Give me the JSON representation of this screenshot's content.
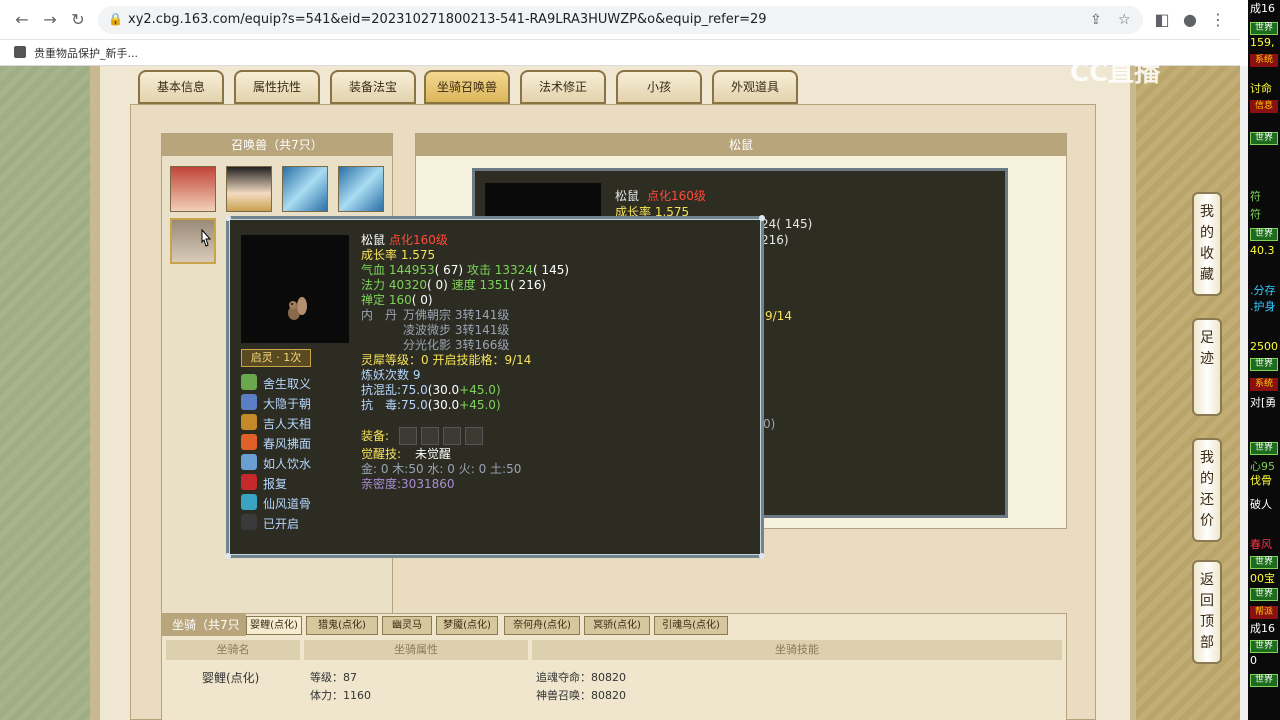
{
  "browser": {
    "url": "xy2.cbg.163.com/equip?s=541&eid=202310271800213-541-RA9LRA3HUWZP&o&equip_refer=29",
    "bookmark": "贵重物品保护_新手..."
  },
  "tabs": [
    "基本信息",
    "属性抗性",
    "装备法宝",
    "坐骑召唤兽",
    "法术修正",
    "小孩",
    "外观道具"
  ],
  "active_tab": "坐骑召唤兽",
  "pet_panel": {
    "title": "召唤兽（共7只）"
  },
  "detail_panel": {
    "title": "松鼠",
    "bg_name": "松鼠",
    "bg_level": "点化160级",
    "bg_growth": "成长率 1.575",
    "bg_attack_tail": "24( 145)",
    "bg_speed_tail": "216)",
    "bg_slots_tail": "9/14",
    "bg_misc_tail": "0)"
  },
  "popup": {
    "name": "松鼠",
    "level": "点化160级",
    "growth": "成长率 1.575",
    "hp_label": "气血",
    "hp_value": "144953",
    "hp_bonus": "( 67)",
    "atk_label": "攻击",
    "atk_value": "13324",
    "atk_bonus": "( 145)",
    "mp_label": "法力",
    "mp_value": "40320",
    "mp_bonus": "( 0)",
    "spd_label": "速度",
    "spd_value": "1351",
    "spd_bonus": "( 216)",
    "chan_label": "禅定",
    "chan_value": "160",
    "chan_bonus": "( 0)",
    "neidan_label": "内　丹",
    "neidan": [
      "万佛朝宗 3转141级",
      "凌波微步 3转141级",
      "分光化影 3转166级"
    ],
    "lingxi": "灵犀等级：0 开启技能格：9/14",
    "lianyao": "炼妖次数 9",
    "resist1_label": "抗混乱:",
    "resist1_value": "75.0",
    "resist1_base": "(30.0",
    "resist1_plus": "+45.0)",
    "resist2_label": "抗　毒:",
    "resist2_value": "75.0",
    "resist2_base": "(30.0",
    "resist2_plus": "+45.0)",
    "equip_label": "装备:",
    "awaken_label": "觉醒技:",
    "awaken_value": "未觉醒",
    "elements": "金: 0 木:50 水: 0 火: 0 土:50",
    "intimacy": "亲密度:3031860",
    "qiling": "启灵 · 1次",
    "skills": [
      {
        "name": "舍生取义",
        "color": "#6aa84f"
      },
      {
        "name": "大隐于朝",
        "color": "#5b7fc4"
      },
      {
        "name": "吉人天相",
        "color": "#c48a2a"
      },
      {
        "name": "春风拂面",
        "color": "#e0602a"
      },
      {
        "name": "如人饮水",
        "color": "#6a9fd4"
      },
      {
        "name": "报复",
        "color": "#c42a2a"
      },
      {
        "name": "仙风道骨",
        "color": "#3aa4c4"
      },
      {
        "name": "已开启",
        "color": "#3a3a3a"
      }
    ]
  },
  "mount_panel": {
    "title": "坐骑（共7只",
    "tabs": [
      "婴鲤(点化)",
      "猎鬼(点化)",
      "幽灵马",
      "梦魇(点化)",
      "奈何舟(点化)",
      "冥骄(点化)",
      "引魂鸟(点化)"
    ],
    "headers": [
      "坐骑名",
      "坐骑属性",
      "坐骑技能"
    ],
    "row": {
      "name": "婴鲤(点化)",
      "level": "等级：87",
      "next": "体力：1160",
      "stat1": "追魂夺命：80820",
      "stat2": "神兽召唤：80820"
    }
  },
  "side_buttons": [
    {
      "label": "我的收藏"
    },
    {
      "label": "足迹"
    },
    {
      "label": "我的还价"
    },
    {
      "label": "返回顶部"
    }
  ],
  "watermark": "CC直播",
  "chat": {
    "lines": [
      "成16",
      "159,",
      "讨命",
      "符",
      "符",
      "40.3",
      ".分存",
      ".护身",
      "2500",
      "对[勇",
      "心95",
      "伐骨",
      "破人",
      "春风",
      "00宝",
      "成16",
      "0"
    ],
    "world_tag": "世界",
    "sys_tag": "系统",
    "info_tag": "信息",
    "gang_tag": "帮派"
  }
}
